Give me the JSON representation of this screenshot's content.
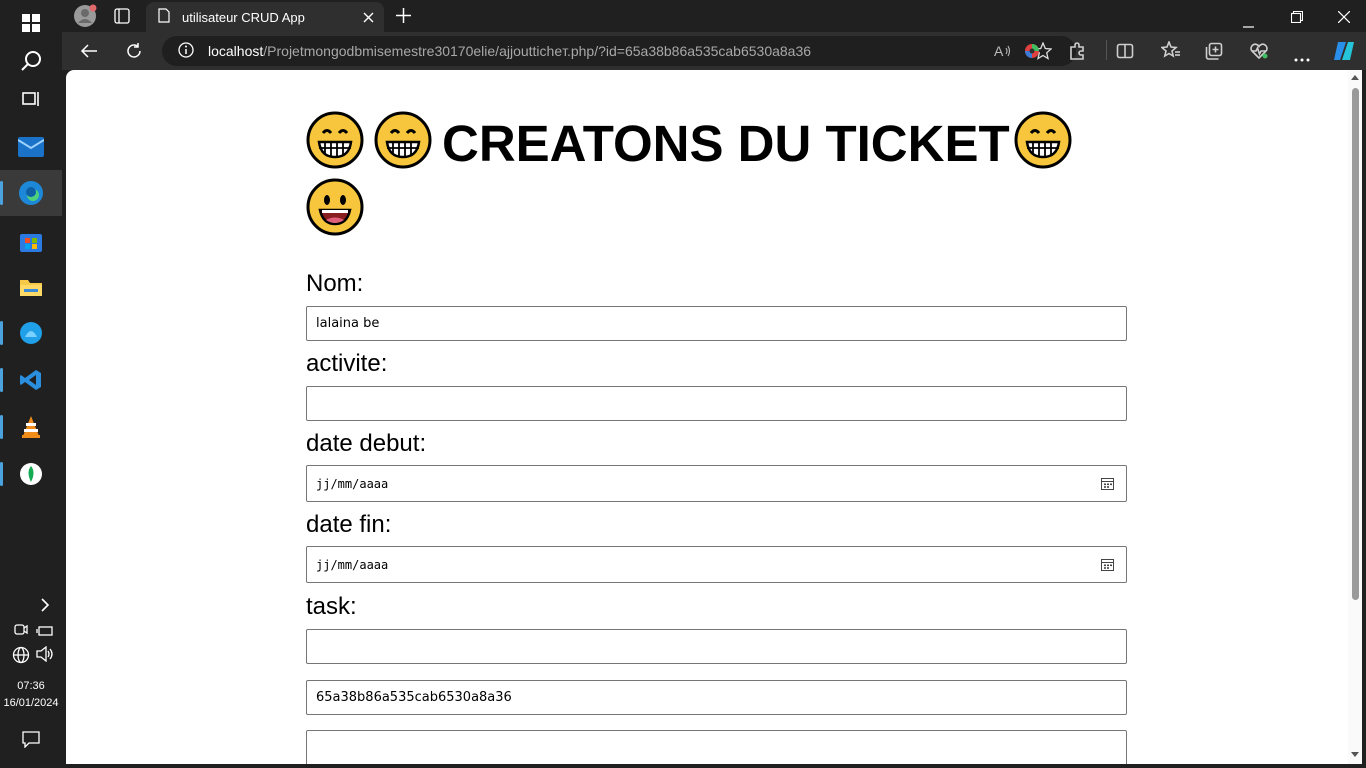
{
  "browser": {
    "tab_title": "utilisateur CRUD App",
    "url_host": "localhost",
    "url_path": "/Projetmongodbmisemestre30170elie/ajjoutticheт.php/?id=65a38b86a535cab6530a8a36"
  },
  "taskbar": {
    "time": "07:36",
    "date": "16/01/2024"
  },
  "form": {
    "heading": "CREATONS DU TICKET",
    "fields": [
      {
        "label": "Nom:",
        "value": "lalaina be"
      },
      {
        "label": "activite:",
        "value": ""
      },
      {
        "label": "date debut:",
        "placeholder": "jj/mm/aaaa"
      },
      {
        "label": "date fin:",
        "placeholder": "jj/mm/aaaa"
      },
      {
        "label": "task:",
        "value": ""
      }
    ],
    "hidden_id_value": "65a38b86a535cab6530a8a36",
    "extra_value": ""
  }
}
